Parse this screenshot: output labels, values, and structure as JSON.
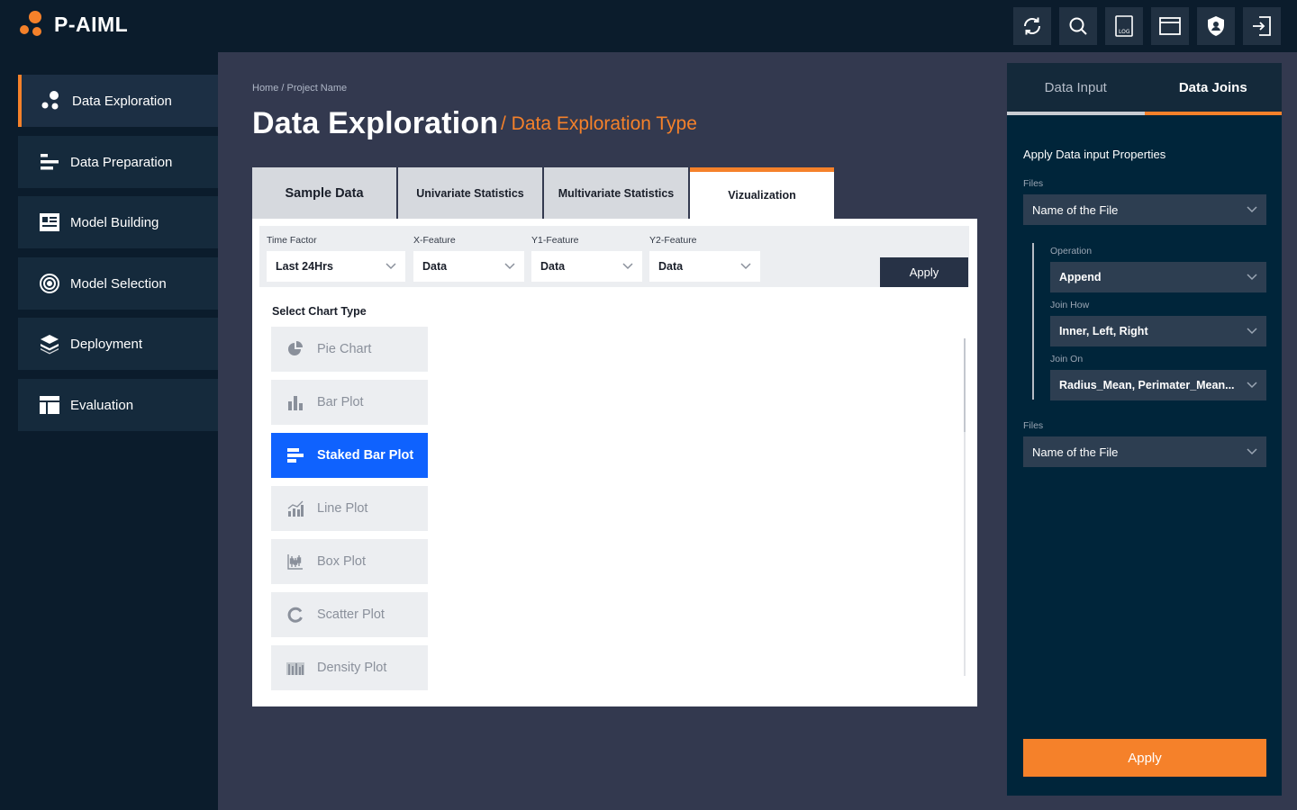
{
  "app": {
    "title": "P-AIML"
  },
  "header_icons": [
    "refresh-icon",
    "search-icon",
    "log-icon",
    "window-icon",
    "shield-icon",
    "logout-icon"
  ],
  "sidebar": {
    "items": [
      {
        "label": "Data Exploration",
        "icon": "data-exploration-icon",
        "active": true
      },
      {
        "label": "Data Preparation",
        "icon": "data-preparation-icon"
      },
      {
        "label": "Model Building",
        "icon": "model-building-icon"
      },
      {
        "label": "Model Selection",
        "icon": "target-icon"
      },
      {
        "label": "Deployment",
        "icon": "layers-icon"
      },
      {
        "label": "Evaluation",
        "icon": "table-layout-icon"
      }
    ]
  },
  "breadcrumb": "Home / Project Name",
  "page": {
    "title": "Data Exploration",
    "subtitle": "/ Data Exploration Type"
  },
  "tabs": [
    {
      "label": "Sample Data"
    },
    {
      "label": "Univariate Statistics"
    },
    {
      "label": "Multivariate Statistics"
    },
    {
      "label": "Vizualization",
      "active": true
    }
  ],
  "filters": {
    "time_factor": {
      "label": "Time Factor",
      "value": "Last 24Hrs"
    },
    "x_feature": {
      "label": "X-Feature",
      "value": "Data"
    },
    "y1_feature": {
      "label": "Y1-Feature",
      "value": "Data"
    },
    "y2_feature": {
      "label": "Y2-Feature",
      "value": "Data"
    },
    "apply_label": "Apply"
  },
  "chart_types": {
    "label": "Select Chart Type",
    "items": [
      {
        "label": "Pie Chart",
        "icon": "pie-chart-icon"
      },
      {
        "label": "Bar Plot",
        "icon": "bar-chart-icon"
      },
      {
        "label": "Staked Bar Plot",
        "icon": "stacked-bar-icon",
        "active": true
      },
      {
        "label": "Line Plot",
        "icon": "line-plot-icon"
      },
      {
        "label": "Box Plot",
        "icon": "box-plot-icon"
      },
      {
        "label": "Scatter Plot",
        "icon": "scatter-plot-icon"
      },
      {
        "label": "Density Plot",
        "icon": "density-plot-icon"
      }
    ]
  },
  "right_panel": {
    "tabs": [
      {
        "label": "Data Input"
      },
      {
        "label": "Data Joins",
        "active": true
      }
    ],
    "section_title": "Apply Data input Properties",
    "files_label": "Files",
    "files_value": "Name of the File",
    "operation_label": "Operation",
    "operation_value": "Append",
    "join_how_label": "Join How",
    "join_how_value": "Inner, Left, Right",
    "join_on_label": "Join On",
    "join_on_value": "Radius_Mean, Perimater_Mean...",
    "files2_label": "Files",
    "files2_value": "Name of the File",
    "apply_label": "Apply"
  },
  "colors": {
    "accent": "#f5812a",
    "active_chart": "#0f62fe",
    "topbar": "#0b1c2c",
    "main_bg": "#33394f",
    "right_panel": "#00253a"
  }
}
